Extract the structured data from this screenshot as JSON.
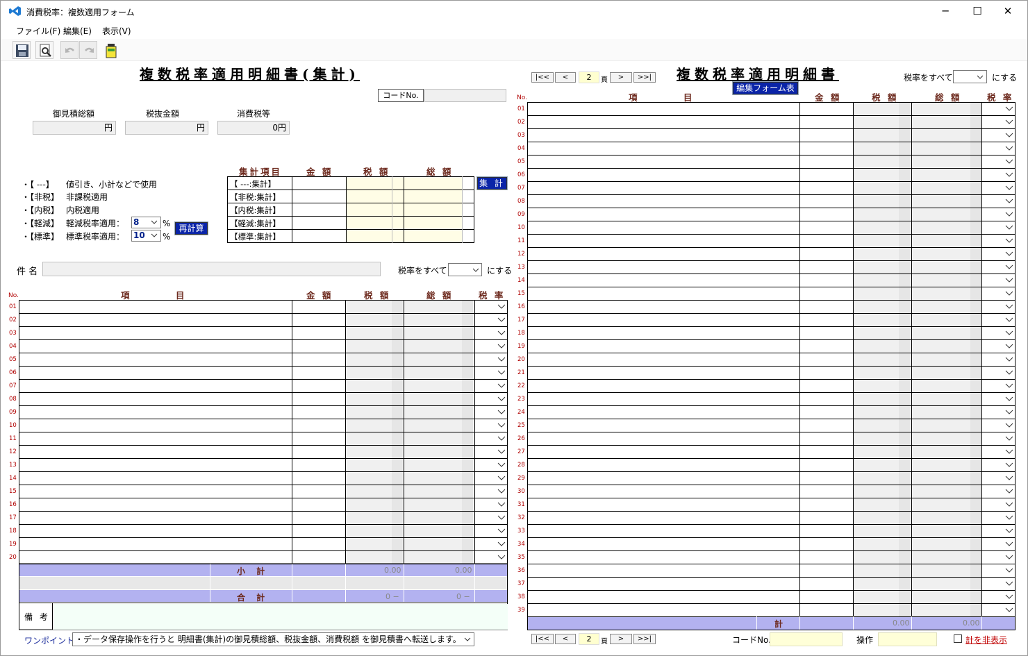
{
  "window": {
    "title": "消費税率：複数適用フォーム",
    "minimize": "─",
    "maximize": "☐",
    "close": "✕"
  },
  "menu": [
    "ファイル(F)",
    "編集(E)",
    "表示(V)"
  ],
  "toolbar": {
    "icons": [
      "save-icon",
      "print-preview-icon",
      "undo-icon",
      "redo-icon",
      "battery-icon"
    ]
  },
  "left": {
    "title": "複数税率適用明細書(集計)",
    "code_label": "コードNo.",
    "code_value": "",
    "totals": {
      "labels": [
        "御見積総額",
        "税抜金額",
        "消費税等"
      ],
      "values": [
        "円",
        "円",
        "0円"
      ]
    },
    "legend": [
      {
        "key": "・【 ---】",
        "desc": "値引き、小計などで使用"
      },
      {
        "key": "・【非税】",
        "desc": "非課税適用"
      },
      {
        "key": "・【内税】",
        "desc": "内税適用"
      },
      {
        "key": "・【軽減】",
        "desc": "軽減税率適用："
      },
      {
        "key": "・【標準】",
        "desc": "標準税率適用："
      }
    ],
    "reduced_rate": "8",
    "standard_rate": "10",
    "percent": "%",
    "recalc_button": "再計算",
    "summary_table": {
      "headers": [
        "集計項目",
        "金 額",
        "税 額",
        "総 額"
      ],
      "rows": [
        "【 ---:集計】",
        "【非税:集計】",
        "【内税:集計】",
        "【軽減:集計】",
        "【標準:集計】"
      ]
    },
    "sum_button": "集 計",
    "subject_label": "件 名",
    "subject_value": "",
    "rate_all_label": "税率をすべて",
    "rate_all_suffix": "にする",
    "detail_headers": [
      "No.",
      "項",
      "目",
      "金 額",
      "税 額",
      "総 額",
      "税 率"
    ],
    "rows": [
      "01",
      "02",
      "03",
      "04",
      "05",
      "06",
      "07",
      "08",
      "09",
      "10",
      "11",
      "12",
      "13",
      "14",
      "15",
      "16",
      "17",
      "18",
      "19",
      "20"
    ],
    "subtotal_label": "小 計",
    "subtotal_tax": "0.00",
    "subtotal_total": "0.00",
    "total_label": "合 計",
    "total_tax": "0 −",
    "total_total": "0 −",
    "remarks_label": "備 考",
    "onepoint_label": "ワンポイント:",
    "onepoint_text": "・データ保存操作を行うと 明細書(集計)の御見積総額、税抜金額、消費税額 を御見積書へ転送します。"
  },
  "right": {
    "title": "複数税率適用明細書",
    "nav": {
      "first": "|<<",
      "prev": "<",
      "page": "2",
      "page_unit": "頁",
      "next": ">",
      "last": ">>|"
    },
    "rate_all_label": "税率をすべて",
    "rate_all_suffix": "にする",
    "edit_form_button": "編集フォーム表示",
    "detail_headers": [
      "No.",
      "項",
      "目",
      "金 額",
      "税 額",
      "総 額",
      "税 率"
    ],
    "rows": [
      "01",
      "02",
      "03",
      "04",
      "05",
      "06",
      "07",
      "08",
      "09",
      "10",
      "11",
      "12",
      "13",
      "14",
      "15",
      "16",
      "17",
      "18",
      "19",
      "20",
      "21",
      "22",
      "23",
      "24",
      "25",
      "26",
      "27",
      "28",
      "29",
      "30",
      "31",
      "32",
      "33",
      "34",
      "35",
      "36",
      "37",
      "38",
      "39"
    ],
    "total_label": "計",
    "total_tax": "0.00",
    "total_total": "0.00",
    "code_label": "コードNo.",
    "operation_label": "操作",
    "hide_total_label": "計を非表示"
  }
}
